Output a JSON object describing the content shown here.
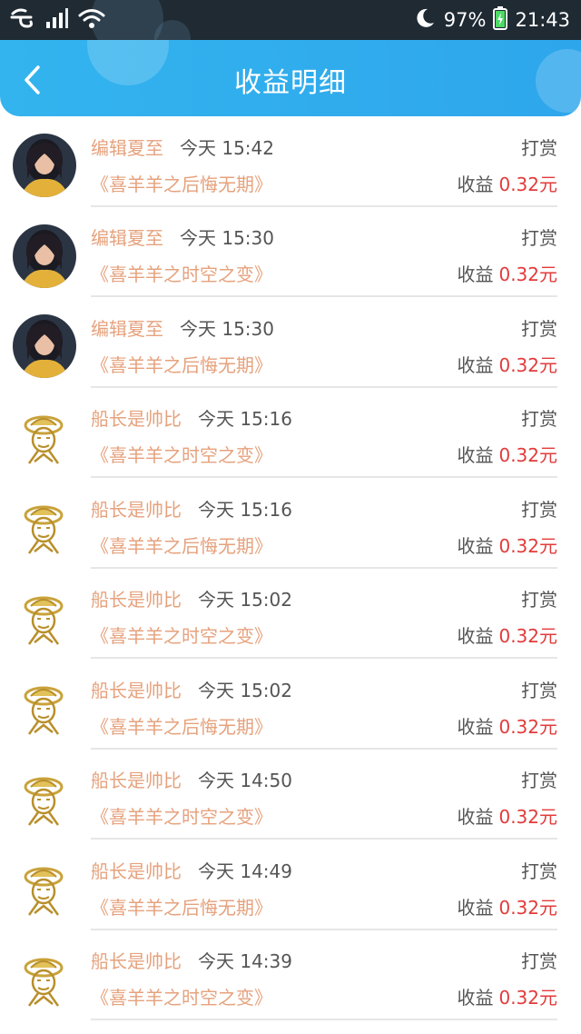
{
  "status_bar": {
    "battery": "97%",
    "time": "21:43",
    "icons": [
      "carrier-icon",
      "signal-icon",
      "wifi-icon",
      "moon-icon",
      "battery-icon"
    ]
  },
  "header": {
    "title": "收益明细",
    "back_icon": "chevron-left-icon",
    "background": "#2ea6ec"
  },
  "colors": {
    "accent_text": "#e6a27d",
    "amount": "#e23b3b",
    "meta_text": "#555555"
  },
  "records": [
    {
      "user": "编辑夏至",
      "time": "今天 15:42",
      "type": "打赏",
      "book": "《喜羊羊之后悔无期》",
      "earn_label": "收益",
      "amount": "0.32元",
      "avatar": "photo-avatar"
    },
    {
      "user": "编辑夏至",
      "time": "今天 15:30",
      "type": "打赏",
      "book": "《喜羊羊之时空之变》",
      "earn_label": "收益",
      "amount": "0.32元",
      "avatar": "photo-avatar"
    },
    {
      "user": "编辑夏至",
      "time": "今天 15:30",
      "type": "打赏",
      "book": "《喜羊羊之后悔无期》",
      "earn_label": "收益",
      "amount": "0.32元",
      "avatar": "photo-avatar"
    },
    {
      "user": "船长是帅比",
      "time": "今天 15:16",
      "type": "打赏",
      "book": "《喜羊羊之时空之变》",
      "earn_label": "收益",
      "amount": "0.32元",
      "avatar": "straw-hat-avatar"
    },
    {
      "user": "船长是帅比",
      "time": "今天 15:16",
      "type": "打赏",
      "book": "《喜羊羊之后悔无期》",
      "earn_label": "收益",
      "amount": "0.32元",
      "avatar": "straw-hat-avatar"
    },
    {
      "user": "船长是帅比",
      "time": "今天 15:02",
      "type": "打赏",
      "book": "《喜羊羊之时空之变》",
      "earn_label": "收益",
      "amount": "0.32元",
      "avatar": "straw-hat-avatar"
    },
    {
      "user": "船长是帅比",
      "time": "今天 15:02",
      "type": "打赏",
      "book": "《喜羊羊之后悔无期》",
      "earn_label": "收益",
      "amount": "0.32元",
      "avatar": "straw-hat-avatar"
    },
    {
      "user": "船长是帅比",
      "time": "今天 14:50",
      "type": "打赏",
      "book": "《喜羊羊之时空之变》",
      "earn_label": "收益",
      "amount": "0.32元",
      "avatar": "straw-hat-avatar"
    },
    {
      "user": "船长是帅比",
      "time": "今天 14:49",
      "type": "打赏",
      "book": "《喜羊羊之后悔无期》",
      "earn_label": "收益",
      "amount": "0.32元",
      "avatar": "straw-hat-avatar"
    },
    {
      "user": "船长是帅比",
      "time": "今天 14:39",
      "type": "打赏",
      "book": "《喜羊羊之时空之变》",
      "earn_label": "收益",
      "amount": "0.32元",
      "avatar": "straw-hat-avatar"
    }
  ]
}
